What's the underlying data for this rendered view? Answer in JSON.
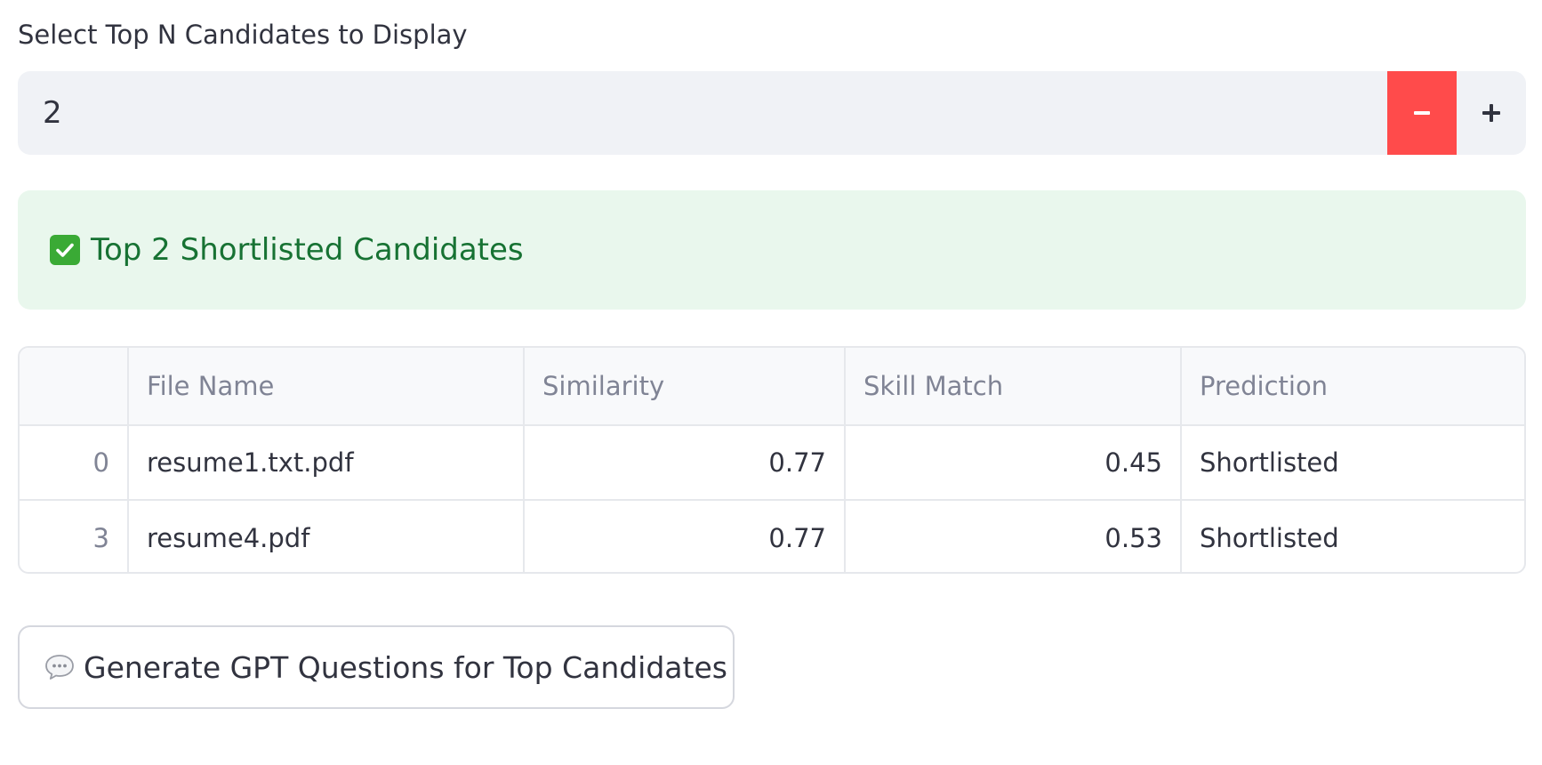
{
  "number_input": {
    "label": "Select Top N Candidates to Display",
    "value": "2",
    "decrement_label": "−",
    "increment_label": "+",
    "accent_color": "#ff4b4b"
  },
  "success_alert": {
    "icon": "check-mark-icon",
    "text": "Top 2 Shortlisted Candidates",
    "background": "#e9f7ed",
    "text_color": "#177233"
  },
  "table": {
    "columns": [
      "",
      "File Name",
      "Similarity",
      "Skill Match",
      "Prediction"
    ],
    "rows": [
      {
        "index": "0",
        "file_name": "resume1.txt.pdf",
        "similarity": "0.77",
        "skill_match": "0.45",
        "prediction": "Shortlisted"
      },
      {
        "index": "3",
        "file_name": "resume4.pdf",
        "similarity": "0.77",
        "skill_match": "0.53",
        "prediction": "Shortlisted"
      }
    ]
  },
  "action_button": {
    "icon": "speech-bubble-icon",
    "label": "Generate GPT Questions for Top Candidates"
  }
}
